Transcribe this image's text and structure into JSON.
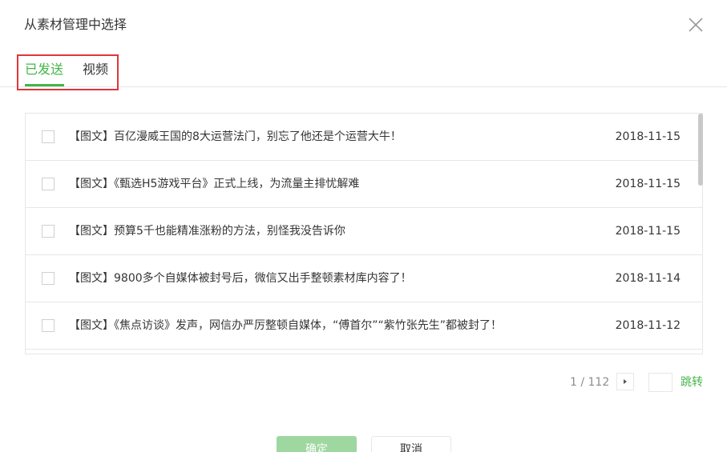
{
  "dialog": {
    "title": "从素材管理中选择"
  },
  "tabs": [
    {
      "label": "已发送",
      "active": true
    },
    {
      "label": "视频",
      "active": false
    }
  ],
  "items": [
    {
      "title": "【图文】百亿漫威王国的8大运营法门，别忘了他还是个运营大牛！",
      "date": "2018-11-15"
    },
    {
      "title": "【图文】《甄选H5游戏平台》正式上线，为流量主排忧解难",
      "date": "2018-11-15"
    },
    {
      "title": "【图文】预算5千也能精准涨粉的方法，别怪我没告诉你",
      "date": "2018-11-15"
    },
    {
      "title": "【图文】9800多个自媒体被封号后，微信又出手整顿素材库内容了！",
      "date": "2018-11-14"
    },
    {
      "title": "【图文】《焦点访谈》发声，网信办严厉整顿自媒体，“傅首尔”“紫竹张先生”都被封了！",
      "date": "2018-11-12"
    }
  ],
  "pagination": {
    "indicator": "1 / 112",
    "jump_label": "跳转",
    "input_value": ""
  },
  "buttons": {
    "ok": "确定",
    "cancel": "取消"
  },
  "colors": {
    "accent": "#44b549",
    "highlight": "#e0363a"
  },
  "icons": {
    "close": "close-icon",
    "next": "chevron-right-icon"
  }
}
